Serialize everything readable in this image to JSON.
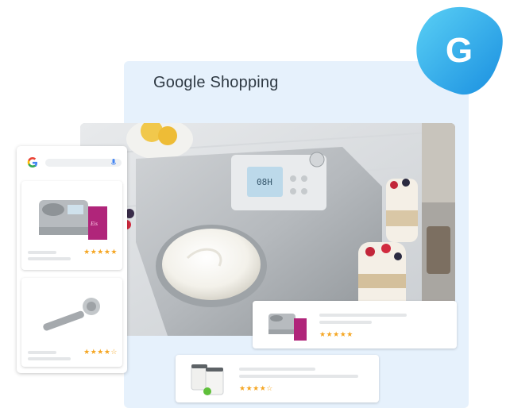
{
  "panel": {
    "title": "Google Shopping"
  },
  "badge": {
    "letter": "G",
    "color_start": "#3fb7ee",
    "color_end": "#1a8fe0"
  },
  "phone": {
    "google_icon": "google-g-icon",
    "mic_icon": "microphone-icon",
    "results": [
      {
        "product": "ice-cream-maker-with-book",
        "rating_stars": "★★★★★"
      },
      {
        "product": "ice-cream-scoop",
        "rating_stars": "★★★★☆"
      }
    ]
  },
  "ad_cards": [
    {
      "product": "ice-cream-maker-with-book",
      "rating_stars": "★★★★★"
    },
    {
      "product": "ice-cream-containers",
      "rating_stars": "★★★★☆"
    }
  ],
  "colors": {
    "panel_bg": "#e6f1fc",
    "star": "#f5a623",
    "accent": "#1a8fe0"
  }
}
